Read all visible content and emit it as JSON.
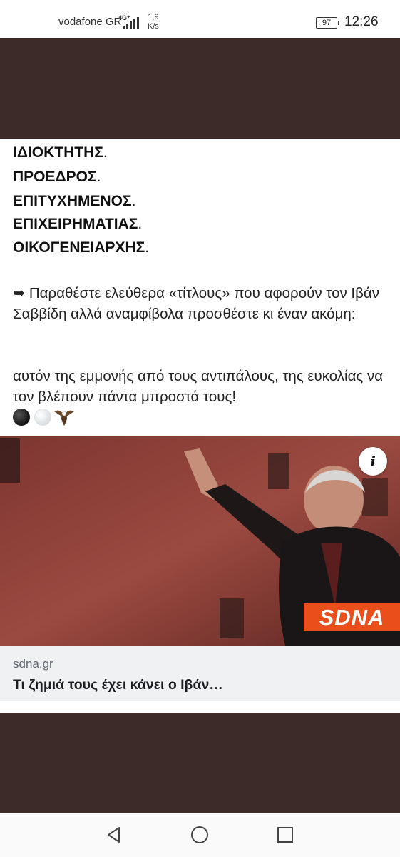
{
  "status_bar": {
    "carrier": "vodafone GR",
    "network": "4G⁺",
    "speed_value": "1,9",
    "speed_unit": "K/s",
    "battery": "97",
    "time": "12:26"
  },
  "post": {
    "title_lines": [
      {
        "word": "ΙΔΙΟΚΤΗΤΗΣ",
        "punct": "."
      },
      {
        "word": "ΠΡΟΕΔΡΟΣ",
        "punct": "."
      },
      {
        "word": "ΕΠΙΤΥΧΗΜΕΝΟΣ",
        "punct": "."
      },
      {
        "word": "ΕΠΙΧΕΙΡΗΜΑΤΙΑΣ",
        "punct": "."
      },
      {
        "word": "ΟΙΚΟΓΕΝΕΙΑΡΧΗΣ",
        "punct": "."
      }
    ],
    "paragraph1": "➥ Παραθέστε ελεύθερα «τίτλους» που αφορούν τον Ιβάν Σαββίδη αλλά αναμφίβολα προσθέστε κι έναν ακόμη:",
    "paragraph2": "αυτόν της εμμονής από τους αντιπάλους, της ευκολίας να τον βλέπουν πάντα μπροστά τους!",
    "emojis": [
      "black-circle",
      "white-circle",
      "eagle"
    ]
  },
  "link_card": {
    "info_label": "i",
    "logo_text": "SDNA",
    "domain": "sdna.gr",
    "title": "Τι ζημιά τους έχει κάνει ο Ιβάν…"
  },
  "colors": {
    "dark_band": "#3c2b27",
    "logo_bg": "#e94e1b",
    "footer_bg": "#f0f1f3"
  },
  "nav": {
    "icons": [
      "back-icon",
      "home-icon",
      "recents-icon"
    ]
  }
}
